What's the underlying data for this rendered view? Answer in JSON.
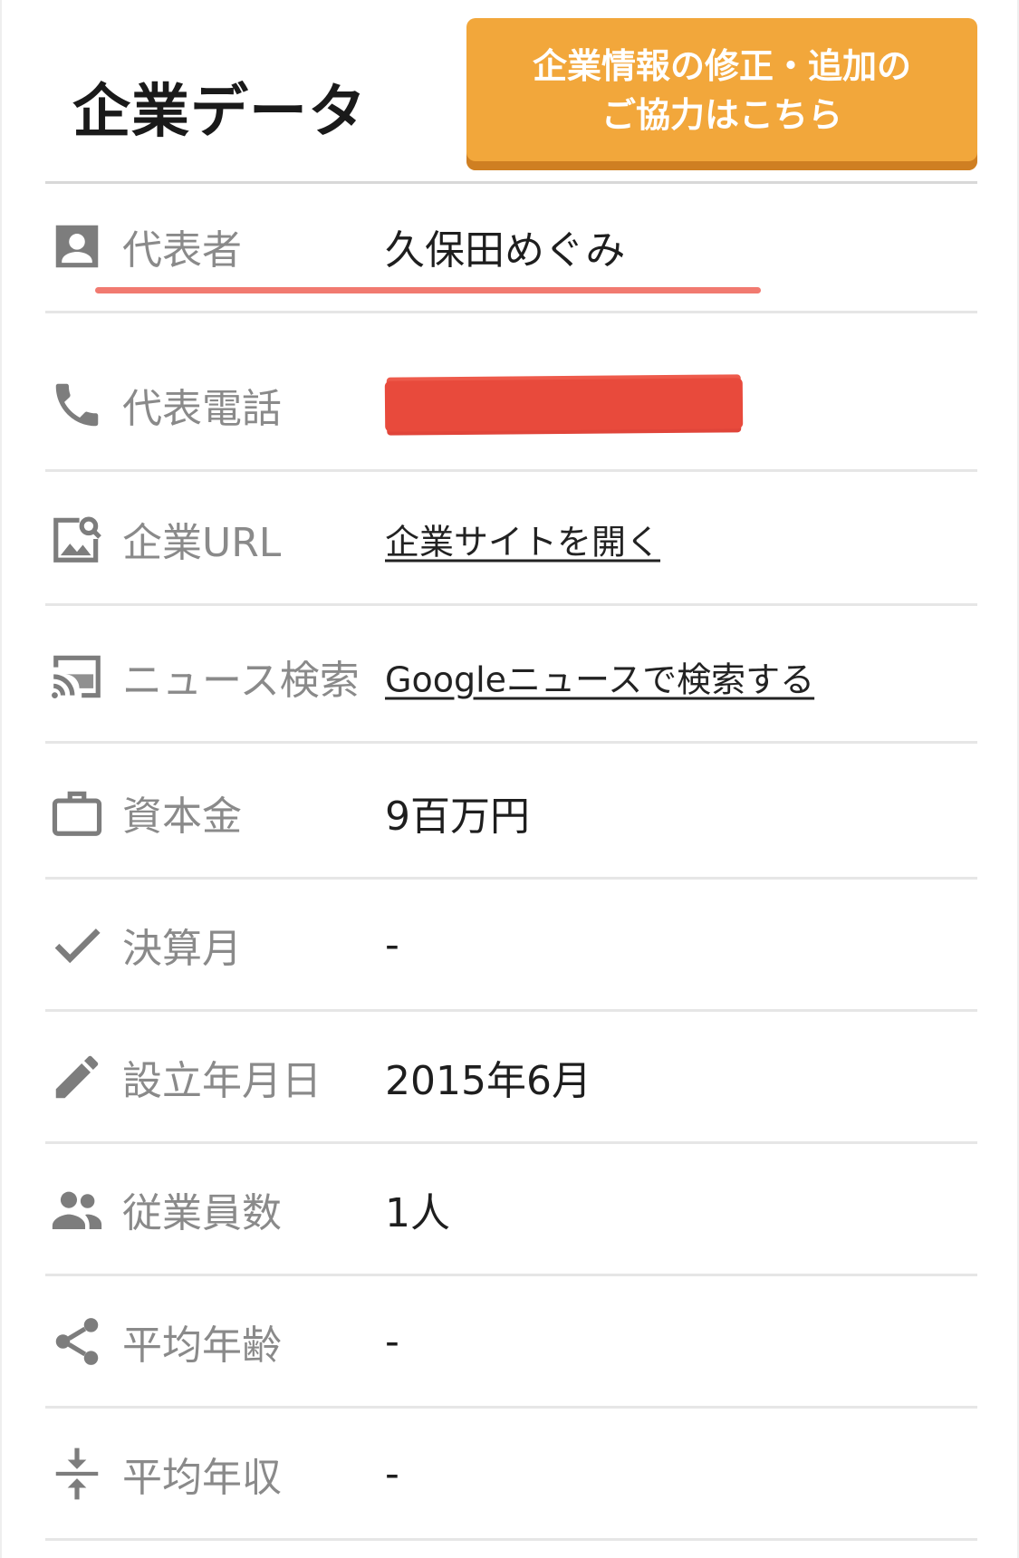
{
  "header": {
    "title": "企業データ",
    "fix_button_line1": "企業情報の修正・追加の",
    "fix_button_line2": "ご協力はこちら"
  },
  "rows": [
    {
      "icon": "person-card-icon",
      "label": "代表者",
      "value": "久保田めぐみ"
    },
    {
      "icon": "phone-icon",
      "label": "代表電話",
      "value": "",
      "redacted": true
    },
    {
      "icon": "image-search-icon",
      "label": "企業URL",
      "value": "企業サイトを開く"
    },
    {
      "icon": "cast-icon",
      "label": "ニュース検索",
      "value": "Googleニュースで検索する"
    },
    {
      "icon": "briefcase-icon",
      "label": "資本金",
      "value": "9百万円"
    },
    {
      "icon": "check-icon",
      "label": "決算月",
      "value": "-"
    },
    {
      "icon": "pencil-icon",
      "label": "設立年月日",
      "value": "2015年6月"
    },
    {
      "icon": "people-icon",
      "label": "従業員数",
      "value": "1人"
    },
    {
      "icon": "share-icon",
      "label": "平均年齢",
      "value": "-"
    },
    {
      "icon": "compress-icon",
      "label": "平均年収",
      "value": "-"
    }
  ],
  "colors": {
    "accent": "#f2a73b",
    "accent_shadow": "#cf7f22",
    "redaction": "#e84a3c",
    "label_gray": "#8a8a8a",
    "icon_gray": "#7d7d7d"
  }
}
